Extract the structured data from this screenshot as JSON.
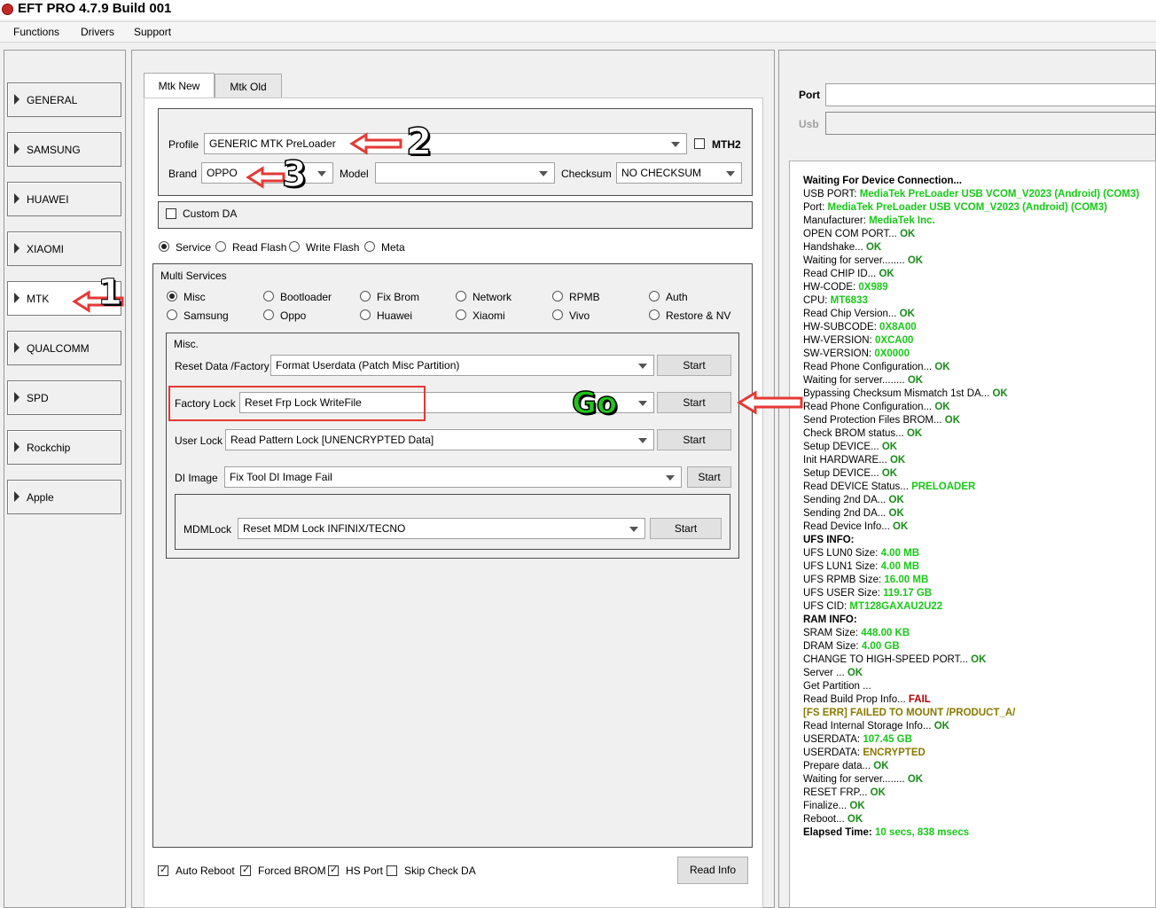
{
  "window": {
    "title": "EFT PRO 4.7.9 Build 001"
  },
  "menu": [
    "Functions",
    "Drivers",
    "Support"
  ],
  "sidebar": {
    "items": [
      "GENERAL",
      "SAMSUNG",
      "HUAWEI",
      "XIAOMI",
      "MTK",
      "QUALCOMM",
      "SPD",
      "Rockchip",
      "Apple"
    ],
    "active": "MTK"
  },
  "tabs": [
    "Mtk New",
    "Mtk Old"
  ],
  "config": {
    "profile_label": "Profile",
    "profile_value": "GENERIC MTK PreLoader",
    "mth2_label": "MTH2",
    "brand_label": "Brand",
    "brand_value": "OPPO",
    "model_label": "Model",
    "model_value": "",
    "checksum_label": "Checksum",
    "checksum_value": "NO CHECKSUM",
    "custom_da_label": "Custom DA"
  },
  "modes": [
    "Service",
    "Read Flash",
    "Write Flash",
    "Meta"
  ],
  "multi_services": {
    "title": "Multi Services",
    "options": [
      "Misc",
      "Bootloader",
      "Fix Brom",
      "Network",
      "RPMB",
      "Auth",
      "Samsung",
      "Oppo",
      "Huawei",
      "Xiaomi",
      "Vivo",
      "Restore & NV"
    ]
  },
  "misc": {
    "title": "Misc.",
    "rows": [
      {
        "label": "Reset Data /Factory",
        "value": "Format Userdata (Patch Misc Partition)",
        "button": "Start"
      },
      {
        "label": "Factory Lock",
        "value": "Reset Frp Lock WriteFile",
        "button": "Start"
      },
      {
        "label": "User Lock",
        "value": "Read Pattern Lock [UNENCRYPTED Data]",
        "button": "Start"
      },
      {
        "label": "DI Image",
        "value": "Fix Tool DI Image Fail",
        "button": "Start"
      },
      {
        "label": "MDMLock",
        "value": "Reset MDM Lock INFINIX/TECNO",
        "button": "Start"
      }
    ]
  },
  "options": [
    {
      "label": "Auto Reboot",
      "checked": true
    },
    {
      "label": "Forced BROM",
      "checked": true
    },
    {
      "label": "HS Port",
      "checked": true
    },
    {
      "label": "Skip Check DA",
      "checked": false
    }
  ],
  "read_info_button": "Read Info",
  "port": {
    "port_label": "Port",
    "usb_label": "Usb"
  },
  "annotations": {
    "one": "1",
    "two": "2",
    "three": "3",
    "go": "Go"
  },
  "log": [
    [
      [
        "Waiting For Device Connection...",
        "b"
      ]
    ],
    [
      [
        "USB PORT: ",
        ""
      ],
      [
        "MediaTek PreLoader USB VCOM_V2023 (Android) (COM3)",
        "g"
      ]
    ],
    [
      [
        "Port: ",
        ""
      ],
      [
        "MediaTek PreLoader USB VCOM_V2023 (Android) (COM3)",
        "g"
      ]
    ],
    [
      [
        "Manufacturer: ",
        ""
      ],
      [
        "MediaTek Inc.",
        "g"
      ]
    ],
    [
      [
        "OPEN COM PORT... ",
        ""
      ],
      [
        "OK",
        "ok"
      ]
    ],
    [
      [
        "Handshake... ",
        ""
      ],
      [
        "OK",
        "ok"
      ]
    ],
    [
      [
        "Waiting for server........ ",
        ""
      ],
      [
        "OK",
        "ok"
      ]
    ],
    [
      [
        "Read CHIP ID... ",
        ""
      ],
      [
        "OK",
        "ok"
      ]
    ],
    [
      [
        "HW-CODE: ",
        ""
      ],
      [
        "0X989",
        "g"
      ]
    ],
    [
      [
        "CPU: ",
        ""
      ],
      [
        "MT6833",
        "g"
      ]
    ],
    [
      [
        "Read Chip Version... ",
        ""
      ],
      [
        "OK",
        "ok"
      ]
    ],
    [
      [
        "HW-SUBCODE: ",
        ""
      ],
      [
        "0X8A00",
        "g"
      ]
    ],
    [
      [
        "HW-VERSION: ",
        ""
      ],
      [
        "0XCA00",
        "g"
      ]
    ],
    [
      [
        "SW-VERSION: ",
        ""
      ],
      [
        "0X0000",
        "g"
      ]
    ],
    [
      [
        "Read Phone Configuration... ",
        ""
      ],
      [
        "OK",
        "ok"
      ]
    ],
    [
      [
        "Waiting for server........ ",
        ""
      ],
      [
        "OK",
        "ok"
      ]
    ],
    [
      [
        "Bypassing Checksum Mismatch 1st DA... ",
        ""
      ],
      [
        "OK",
        "ok"
      ]
    ],
    [
      [
        "Read Phone Configuration... ",
        ""
      ],
      [
        "OK",
        "ok"
      ]
    ],
    [
      [
        "Send Protection Files BROM... ",
        ""
      ],
      [
        "OK",
        "ok"
      ]
    ],
    [
      [
        "Check BROM status... ",
        ""
      ],
      [
        "OK",
        "ok"
      ]
    ],
    [
      [
        "Setup DEVICE... ",
        ""
      ],
      [
        "OK",
        "ok"
      ]
    ],
    [
      [
        "Init HARDWARE... ",
        ""
      ],
      [
        "OK",
        "ok"
      ]
    ],
    [
      [
        "Setup DEVICE... ",
        ""
      ],
      [
        "OK",
        "ok"
      ]
    ],
    [
      [
        "Read DEVICE Status... ",
        ""
      ],
      [
        "PRELOADER",
        "g"
      ]
    ],
    [
      [
        "Sending 2nd DA... ",
        ""
      ],
      [
        "OK",
        "ok"
      ]
    ],
    [
      [
        "Sending 2nd DA... ",
        ""
      ],
      [
        "OK",
        "ok"
      ]
    ],
    [
      [
        "Read Device Info... ",
        ""
      ],
      [
        "OK",
        "ok"
      ]
    ],
    [
      [
        "UFS INFO:",
        "b"
      ]
    ],
    [
      [
        "UFS LUN0 Size: ",
        ""
      ],
      [
        "4.00 MB",
        "g"
      ]
    ],
    [
      [
        "UFS LUN1 Size: ",
        ""
      ],
      [
        "4.00 MB",
        "g"
      ]
    ],
    [
      [
        "UFS RPMB Size: ",
        ""
      ],
      [
        "16.00 MB",
        "g"
      ]
    ],
    [
      [
        "UFS USER Size: ",
        ""
      ],
      [
        "119.17 GB",
        "g"
      ]
    ],
    [
      [
        "UFS CID: ",
        ""
      ],
      [
        "MT128GAXAU2U22",
        "g"
      ]
    ],
    [
      [
        "RAM INFO:",
        "b"
      ]
    ],
    [
      [
        "SRAM Size: ",
        ""
      ],
      [
        "448.00 KB",
        "g"
      ]
    ],
    [
      [
        "DRAM Size: ",
        ""
      ],
      [
        "4.00 GB",
        "g"
      ]
    ],
    [
      [
        "CHANGE TO HIGH-SPEED PORT... ",
        ""
      ],
      [
        "OK",
        "ok"
      ]
    ],
    [
      [
        "Server ... ",
        ""
      ],
      [
        "OK",
        "ok"
      ]
    ],
    [
      [
        "Get Partition ...",
        ""
      ]
    ],
    [
      [
        "Read Build Prop Info... ",
        ""
      ],
      [
        "FAIL",
        "fail"
      ]
    ],
    [
      [
        "  [FS ERR] FAILED TO MOUNT /PRODUCT_A/",
        "olive"
      ]
    ],
    [
      [
        "Read Internal Storage Info... ",
        ""
      ],
      [
        "OK",
        "ok"
      ]
    ],
    [
      [
        "USERDATA: ",
        ""
      ],
      [
        "107.45 GB",
        "g"
      ]
    ],
    [
      [
        "USERDATA: ",
        ""
      ],
      [
        "ENCRYPTED",
        "olive"
      ]
    ],
    [
      [
        "Prepare data... ",
        ""
      ],
      [
        "OK",
        "ok"
      ]
    ],
    [
      [
        "Waiting for server........ ",
        ""
      ],
      [
        "OK",
        "ok"
      ]
    ],
    [
      [
        "RESET FRP... ",
        ""
      ],
      [
        "OK",
        "ok"
      ]
    ],
    [
      [
        "Finalize... ",
        ""
      ],
      [
        "OK",
        "ok"
      ]
    ],
    [
      [
        "Reboot... ",
        ""
      ],
      [
        "OK",
        "ok"
      ]
    ],
    [
      [
        "Elapsed Time: ",
        "b"
      ],
      [
        "10 secs, 838 msecs",
        "g"
      ]
    ]
  ]
}
